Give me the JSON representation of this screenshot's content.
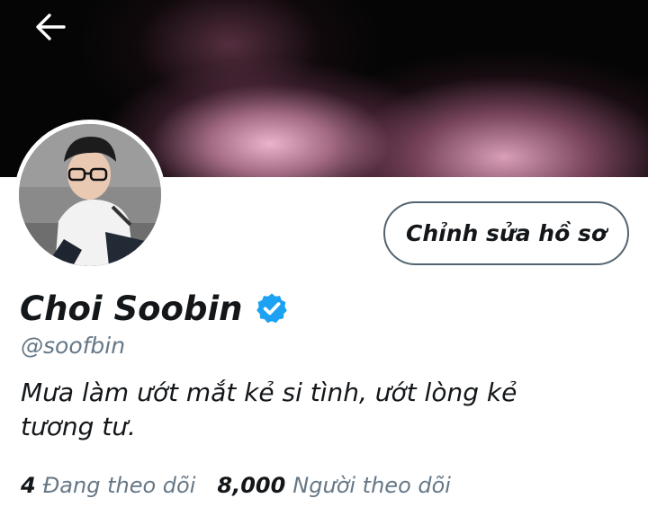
{
  "header": {
    "back_icon": "arrow-left-icon"
  },
  "profile": {
    "display_name": "Choi Soobin",
    "verified_icon": "verified-badge-icon",
    "verified_color": "#1da1f2",
    "handle": "@soofbin",
    "bio_line1": "Mưa làm ướt mắt kẻ si tình, ướt lòng kẻ",
    "bio_line2": "tương tư.",
    "edit_button_label": "Chỉnh sửa hồ sơ"
  },
  "stats": {
    "following_count": "4",
    "following_label": "Đang theo dõi",
    "followers_count": "8,000",
    "followers_label": "Người theo dõi"
  }
}
